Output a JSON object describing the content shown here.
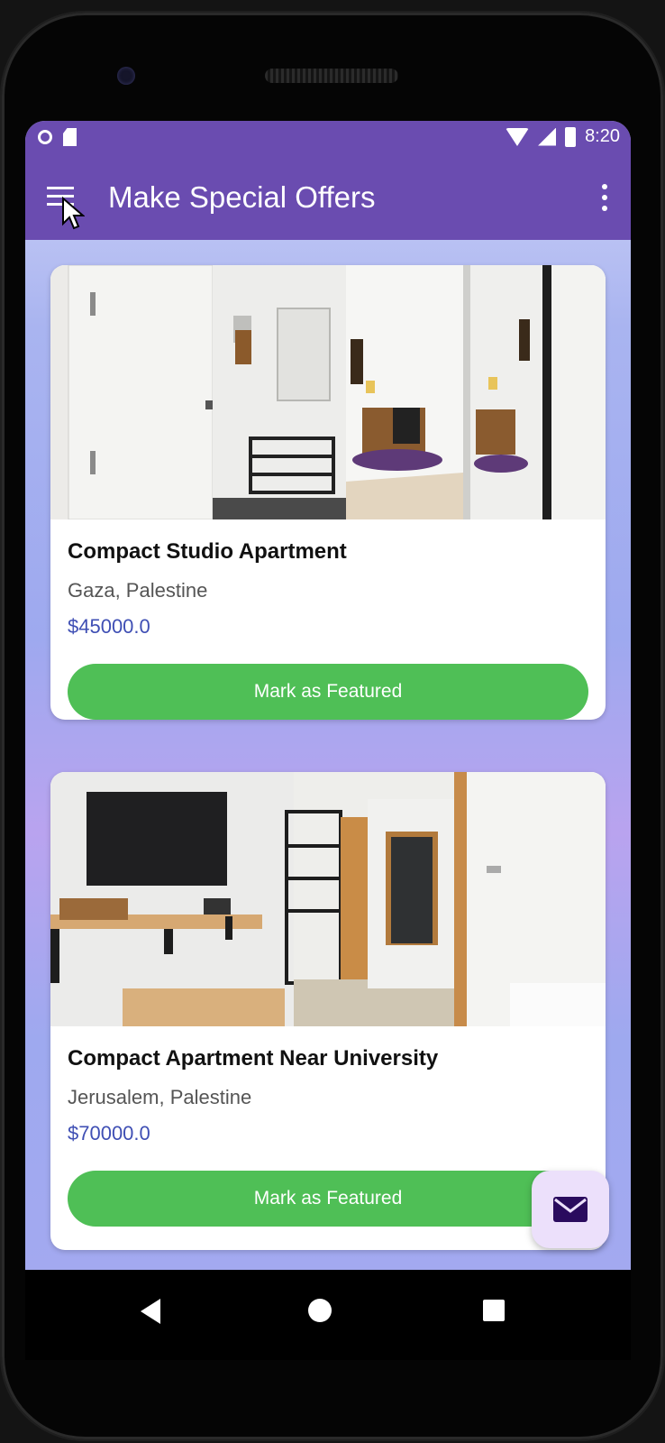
{
  "status_bar": {
    "time": "8:20"
  },
  "app_bar": {
    "title": "Make Special Offers"
  },
  "listings": [
    {
      "title": "Compact Studio Apartment",
      "location": "Gaza, Palestine",
      "price": "$45000.0",
      "button_label": "Mark as Featured"
    },
    {
      "title": "Compact Apartment Near University",
      "location": "Jerusalem, Palestine",
      "price": "$70000.0",
      "button_label": "Mark as Featured"
    }
  ],
  "colors": {
    "primary": "#6a4cb0",
    "button": "#4fbf56",
    "price": "#3f4fb4",
    "fab_bg": "#ece0fb"
  },
  "icons": [
    "menu-icon",
    "more-vert-icon",
    "mail-icon",
    "back-icon",
    "home-icon",
    "recents-icon",
    "wifi-icon",
    "signal-icon",
    "battery-icon"
  ]
}
